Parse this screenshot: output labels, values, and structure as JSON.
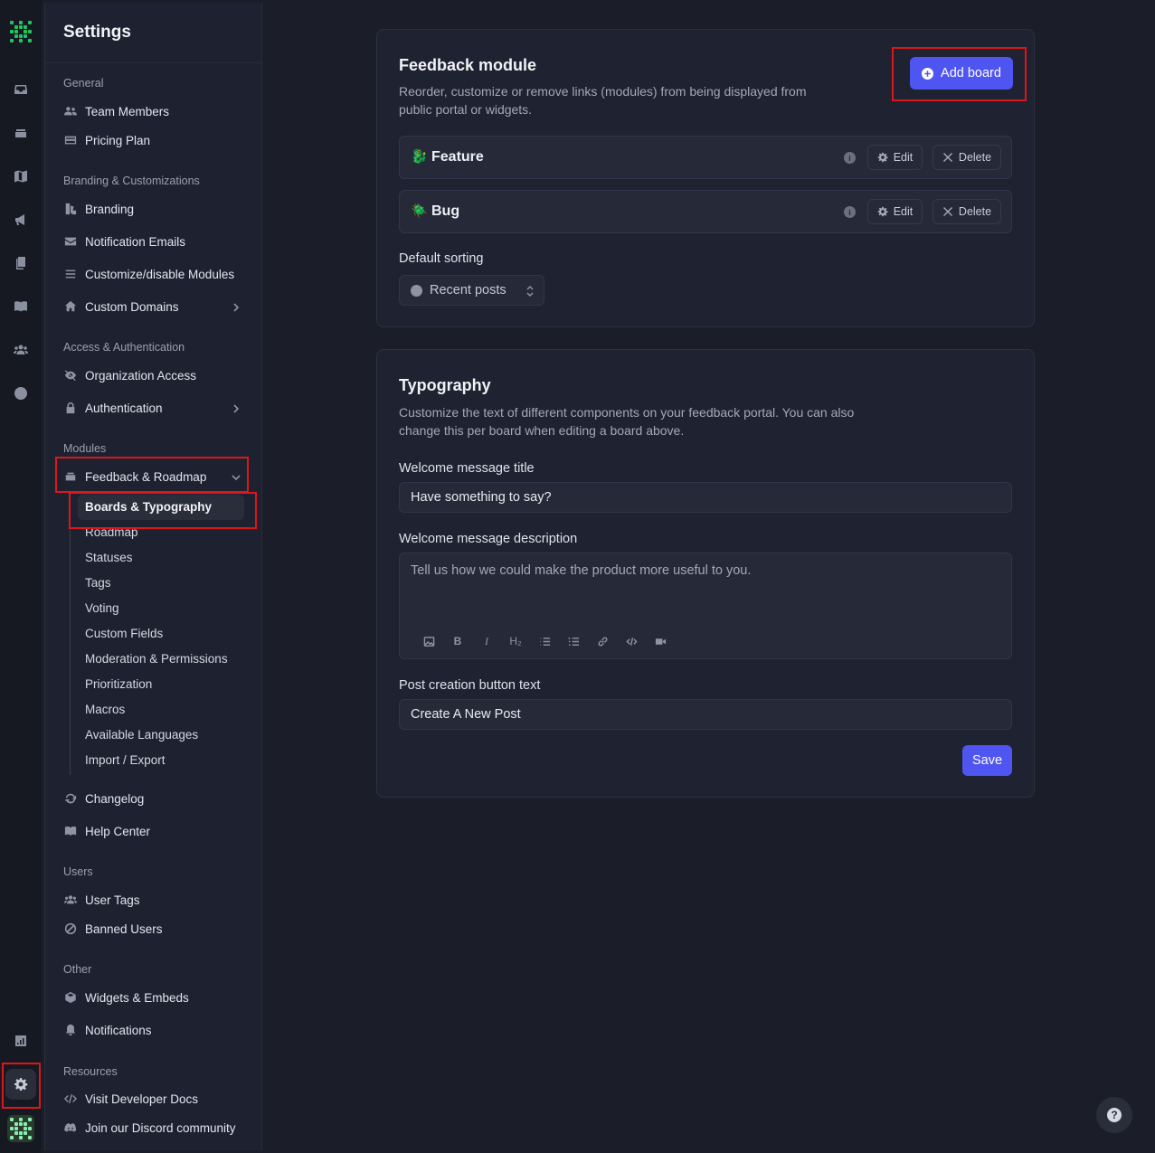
{
  "sidebar": {
    "title": "Settings",
    "sections": {
      "general": "General",
      "branding": "Branding & Customizations",
      "access": "Access & Authentication",
      "modules": "Modules",
      "users": "Users",
      "other": "Other",
      "resources": "Resources"
    },
    "items": {
      "team_members": "Team Members",
      "pricing_plan": "Pricing Plan",
      "branding": "Branding",
      "notification_emails": "Notification Emails",
      "customize_modules": "Customize/disable Modules",
      "custom_domains": "Custom Domains",
      "organization_access": "Organization Access",
      "authentication": "Authentication",
      "feedback_roadmap": "Feedback & Roadmap",
      "changelog": "Changelog",
      "help_center": "Help Center",
      "user_tags": "User Tags",
      "banned_users": "Banned Users",
      "widgets_embeds": "Widgets & Embeds",
      "notifications": "Notifications",
      "developer_docs": "Visit Developer Docs",
      "discord": "Join our Discord community"
    },
    "subitems": [
      "Boards & Typography",
      "Roadmap",
      "Statuses",
      "Tags",
      "Voting",
      "Custom Fields",
      "Moderation & Permissions",
      "Prioritization",
      "Macros",
      "Available Languages",
      "Import / Export"
    ]
  },
  "feedback_module": {
    "title": "Feedback module",
    "description": "Reorder, customize or remove links (modules) from being displayed from public portal or widgets.",
    "add_board_label": "Add board",
    "boards": [
      {
        "emoji": "🐉",
        "name": "Feature"
      },
      {
        "emoji": "🪲",
        "name": "Bug"
      }
    ],
    "edit_label": "Edit",
    "delete_label": "Delete",
    "default_sorting_label": "Default sorting",
    "default_sorting_value": "Recent posts"
  },
  "typography": {
    "title": "Typography",
    "description": "Customize the text of different components on your feedback portal. You can also change this per board when editing a board above.",
    "welcome_title_label": "Welcome message title",
    "welcome_title_value": "Have something to say?",
    "welcome_desc_label": "Welcome message description",
    "welcome_desc_value": "Tell us how we could make the product more useful to you.",
    "post_button_label": "Post creation button text",
    "post_button_value": "Create A New Post",
    "save_label": "Save",
    "toolbar": {
      "h2": "H₂",
      "bold": "B",
      "italic": "I"
    }
  },
  "colors": {
    "accent": "#4f55f1",
    "highlight": "#e0151b",
    "logo_green": "#22c55e"
  }
}
